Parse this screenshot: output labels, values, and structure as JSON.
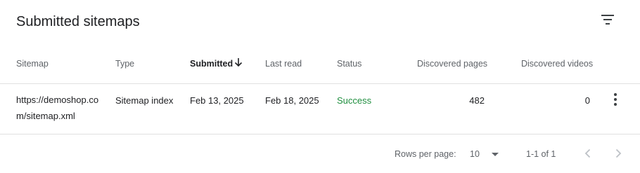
{
  "card": {
    "title": "Submitted sitemaps",
    "filter_icon": "filter-icon"
  },
  "table": {
    "columns": [
      {
        "label": "Sitemap"
      },
      {
        "label": "Type"
      },
      {
        "label": "Submitted",
        "sorted": "desc"
      },
      {
        "label": "Last read"
      },
      {
        "label": "Status"
      },
      {
        "label": "Discovered pages"
      },
      {
        "label": "Discovered videos"
      }
    ],
    "rows": [
      {
        "sitemap": "https://demoshop.com/sitemap.xml",
        "type": "Sitemap index",
        "submitted": "Feb 13, 2025",
        "last_read": "Feb 18, 2025",
        "status": "Success",
        "discovered_pages": "482",
        "discovered_videos": "0"
      }
    ]
  },
  "pagination": {
    "rows_per_page_label": "Rows per page:",
    "rows_per_page_value": "10",
    "range": "1-1 of 1",
    "prev_icon": "chevron-left-icon",
    "next_icon": "chevron-right-icon"
  },
  "colors": {
    "success": "#1e8e3e",
    "header_text": "#5f6368",
    "divider": "#e0e0e0"
  }
}
